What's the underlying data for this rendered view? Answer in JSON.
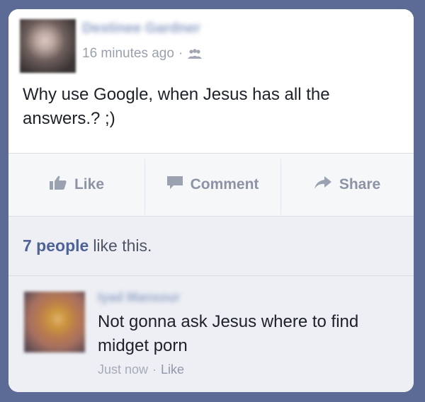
{
  "post": {
    "author_name": "Destinee Gardner",
    "timestamp": "16 minutes ago",
    "separator": "·",
    "text": "Why use Google, when Jesus has all the answers.? ;)"
  },
  "actions": {
    "like": "Like",
    "comment": "Comment",
    "share": "Share"
  },
  "likes": {
    "count": "7 people",
    "suffix": "like this."
  },
  "comment": {
    "author_name": "Iyad Mansour",
    "text": "Not gonna ask Jesus where to find midget porn",
    "time": "Just now",
    "separator": "·",
    "like": "Like"
  },
  "colors": {
    "background": "#5b6b96",
    "link": "#4e6296",
    "action_text": "#8b93a4"
  }
}
